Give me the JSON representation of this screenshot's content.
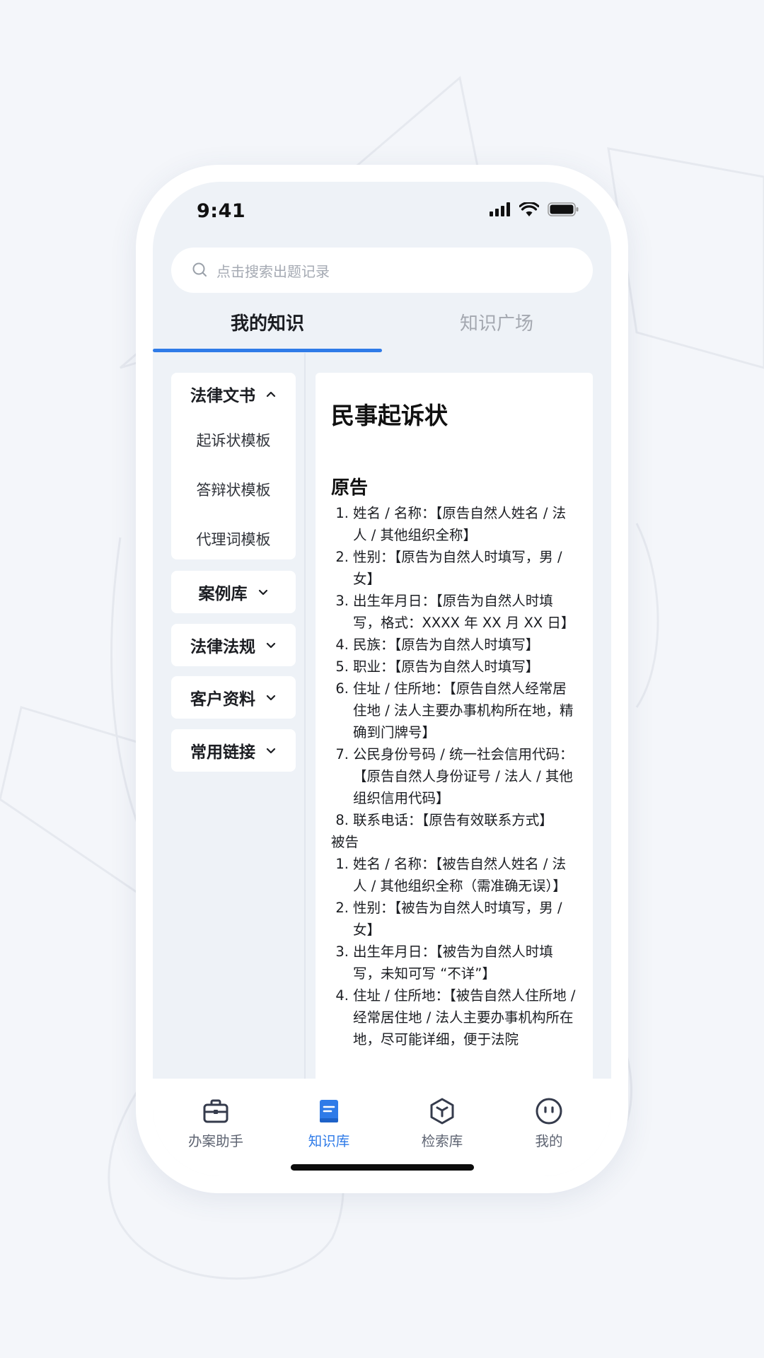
{
  "status": {
    "time": "9:41"
  },
  "search": {
    "placeholder": "点击搜索出题记录"
  },
  "tabs": [
    {
      "label": "我的知识",
      "active": true
    },
    {
      "label": "知识广场",
      "active": false
    }
  ],
  "sidebar": {
    "groups": [
      {
        "label": "法律文书",
        "expanded": true,
        "children": [
          "起诉状模板",
          "答辩状模板",
          "代理词模板"
        ]
      },
      {
        "label": "案例库",
        "expanded": false
      },
      {
        "label": "法律法规",
        "expanded": false
      },
      {
        "label": "客户资料",
        "expanded": false
      },
      {
        "label": "常用链接",
        "expanded": false
      }
    ]
  },
  "document": {
    "title": "民事起诉状",
    "plaintiff_heading": "原告",
    "plaintiff_items": [
      "姓名 / 名称：【原告自然人姓名 / 法人 / 其他组织全称】",
      "性别：【原告为自然人时填写，男 / 女】",
      "出生年月日：【原告为自然人时填写，格式：XXXX 年 XX 月 XX 日】",
      "民族：【原告为自然人时填写】",
      "职业：【原告为自然人时填写】",
      "住址 / 住所地：【原告自然人经常居住地 / 法人主要办事机构所在地，精确到门牌号】",
      "公民身份号码 / 统一社会信用代码：【原告自然人身份证号 / 法人 / 其他组织信用代码】",
      "联系电话：【原告有效联系方式】"
    ],
    "defendant_heading": "被告",
    "defendant_items": [
      "姓名 / 名称：【被告自然人姓名 / 法人 / 其他组织全称（需准确无误）】",
      "性别：【被告为自然人时填写，男 / 女】",
      "出生年月日：【被告为自然人时填写，未知可写 “不详”】",
      "住址 / 住所地：【被告自然人住所地 / 经常居住地 / 法人主要办事机构所在地，尽可能详细，便于法院"
    ]
  },
  "tabbar": [
    {
      "label": "办案助手",
      "icon": "briefcase-icon",
      "active": false
    },
    {
      "label": "知识库",
      "icon": "book-icon",
      "active": true
    },
    {
      "label": "检索库",
      "icon": "cube-icon",
      "active": false
    },
    {
      "label": "我的",
      "icon": "face-icon",
      "active": false
    }
  ],
  "colors": {
    "accent": "#2f7be8",
    "screen_bg": "#eef2f7",
    "page_bg": "#f4f6fa"
  }
}
